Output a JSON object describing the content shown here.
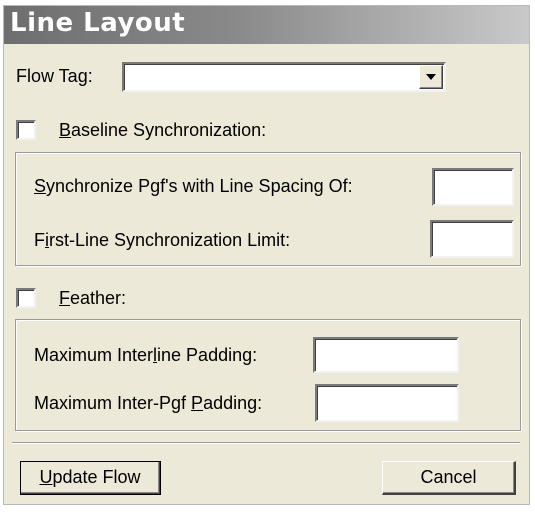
{
  "dialog": {
    "title": "Line Layout"
  },
  "flow_tag": {
    "label_pre": "Flow Tag:",
    "value": ""
  },
  "baseline_sync": {
    "checkbox_checked": false,
    "label_underlined": "B",
    "label_rest": "aseline Synchronization:",
    "sync_spacing": {
      "label_underlined": "S",
      "label_rest": "ynchronize Pgf's with Line Spacing Of:",
      "value": ""
    },
    "first_line_limit": {
      "label_pre": "F",
      "label_underlined": "i",
      "label_rest": "rst-Line Synchronization Limit:",
      "value": ""
    }
  },
  "feather": {
    "checkbox_checked": false,
    "label_underlined": "F",
    "label_rest": "eather:",
    "interline_padding": {
      "label_pre": "Maximum Inter",
      "label_underlined": "l",
      "label_rest": "ine Padding:",
      "value": ""
    },
    "inter_pgf_padding": {
      "label_pre": "Maximum Inter-Pgf ",
      "label_underlined": "P",
      "label_rest": "adding:",
      "value": ""
    }
  },
  "buttons": {
    "update_underlined": "U",
    "update_rest": "pdate Flow",
    "cancel": "Cancel"
  }
}
